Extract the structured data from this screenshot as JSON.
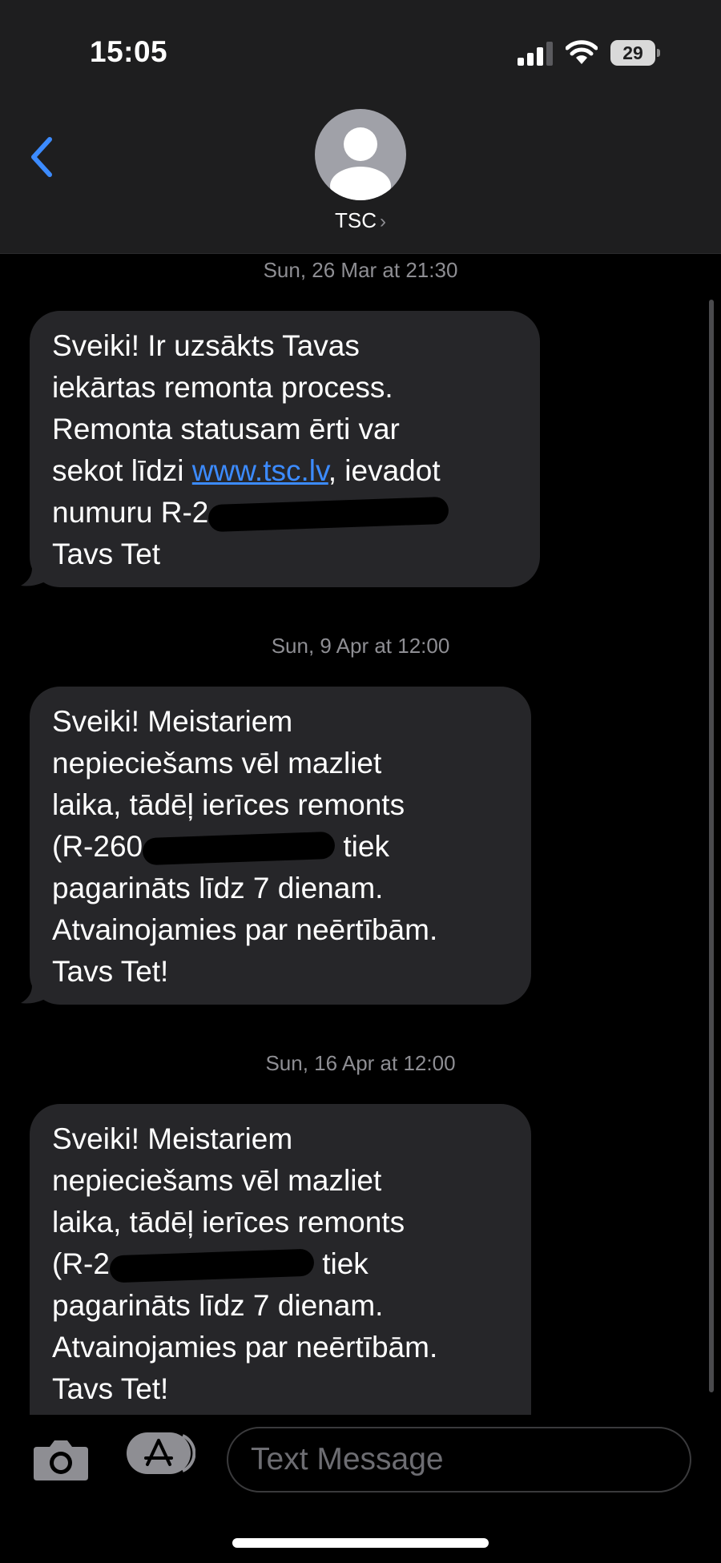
{
  "status_bar": {
    "time": "15:05",
    "battery_level": "29"
  },
  "header": {
    "contact_name": "TSC",
    "chevron": "›"
  },
  "icons": {
    "back": "chevron-left-icon",
    "avatar": "person-icon",
    "camera": "camera-icon",
    "apps": "app-store-icon",
    "signal": "cellular-signal-icon",
    "wifi": "wifi-icon",
    "battery": "battery-icon"
  },
  "colors": {
    "accent": "#3c8bff",
    "bubble": "#262629",
    "background": "#000000",
    "header": "#1e1e1f"
  },
  "messages": [
    {
      "timestamp": "Sun, 26 Mar at 21:30",
      "lines": [
        "Sveiki! Ir uzsākts Tavas",
        "iekārtas remonta process.",
        "Remonta statusam ērti var"
      ],
      "link_line": {
        "before": "sekot līdzi ",
        "link": "www.tsc.lv",
        "after": ", ievadot"
      },
      "redacted_line_prefix": "numuru R-2",
      "closing": "Tavs Tet"
    },
    {
      "timestamp": "Sun, 9 Apr at 12:00",
      "lines": [
        "Sveiki! Meistariem",
        "nepieciešams vēl mazliet",
        "laika, tādēļ ierīces remonts"
      ],
      "redacted_line_prefix": "(R-260",
      "redacted_line_suffix": " tiek",
      "tail_lines": [
        "pagarināts līdz 7 dienam.",
        "Atvainojamies par neērtībām.",
        "Tavs Tet!"
      ]
    },
    {
      "timestamp": "Sun, 16 Apr at 12:00",
      "lines": [
        "Sveiki! Meistariem",
        "nepieciešams vēl mazliet",
        "laika, tādēļ ierīces remonts"
      ],
      "redacted_line_prefix": "(R-2",
      "redacted_line_suffix": " tiek",
      "tail_lines": [
        "pagarināts līdz 7 dienam.",
        "Atvainojamies par neērtībām.",
        "Tavs Tet!"
      ]
    }
  ],
  "composer": {
    "placeholder": "Text Message"
  }
}
